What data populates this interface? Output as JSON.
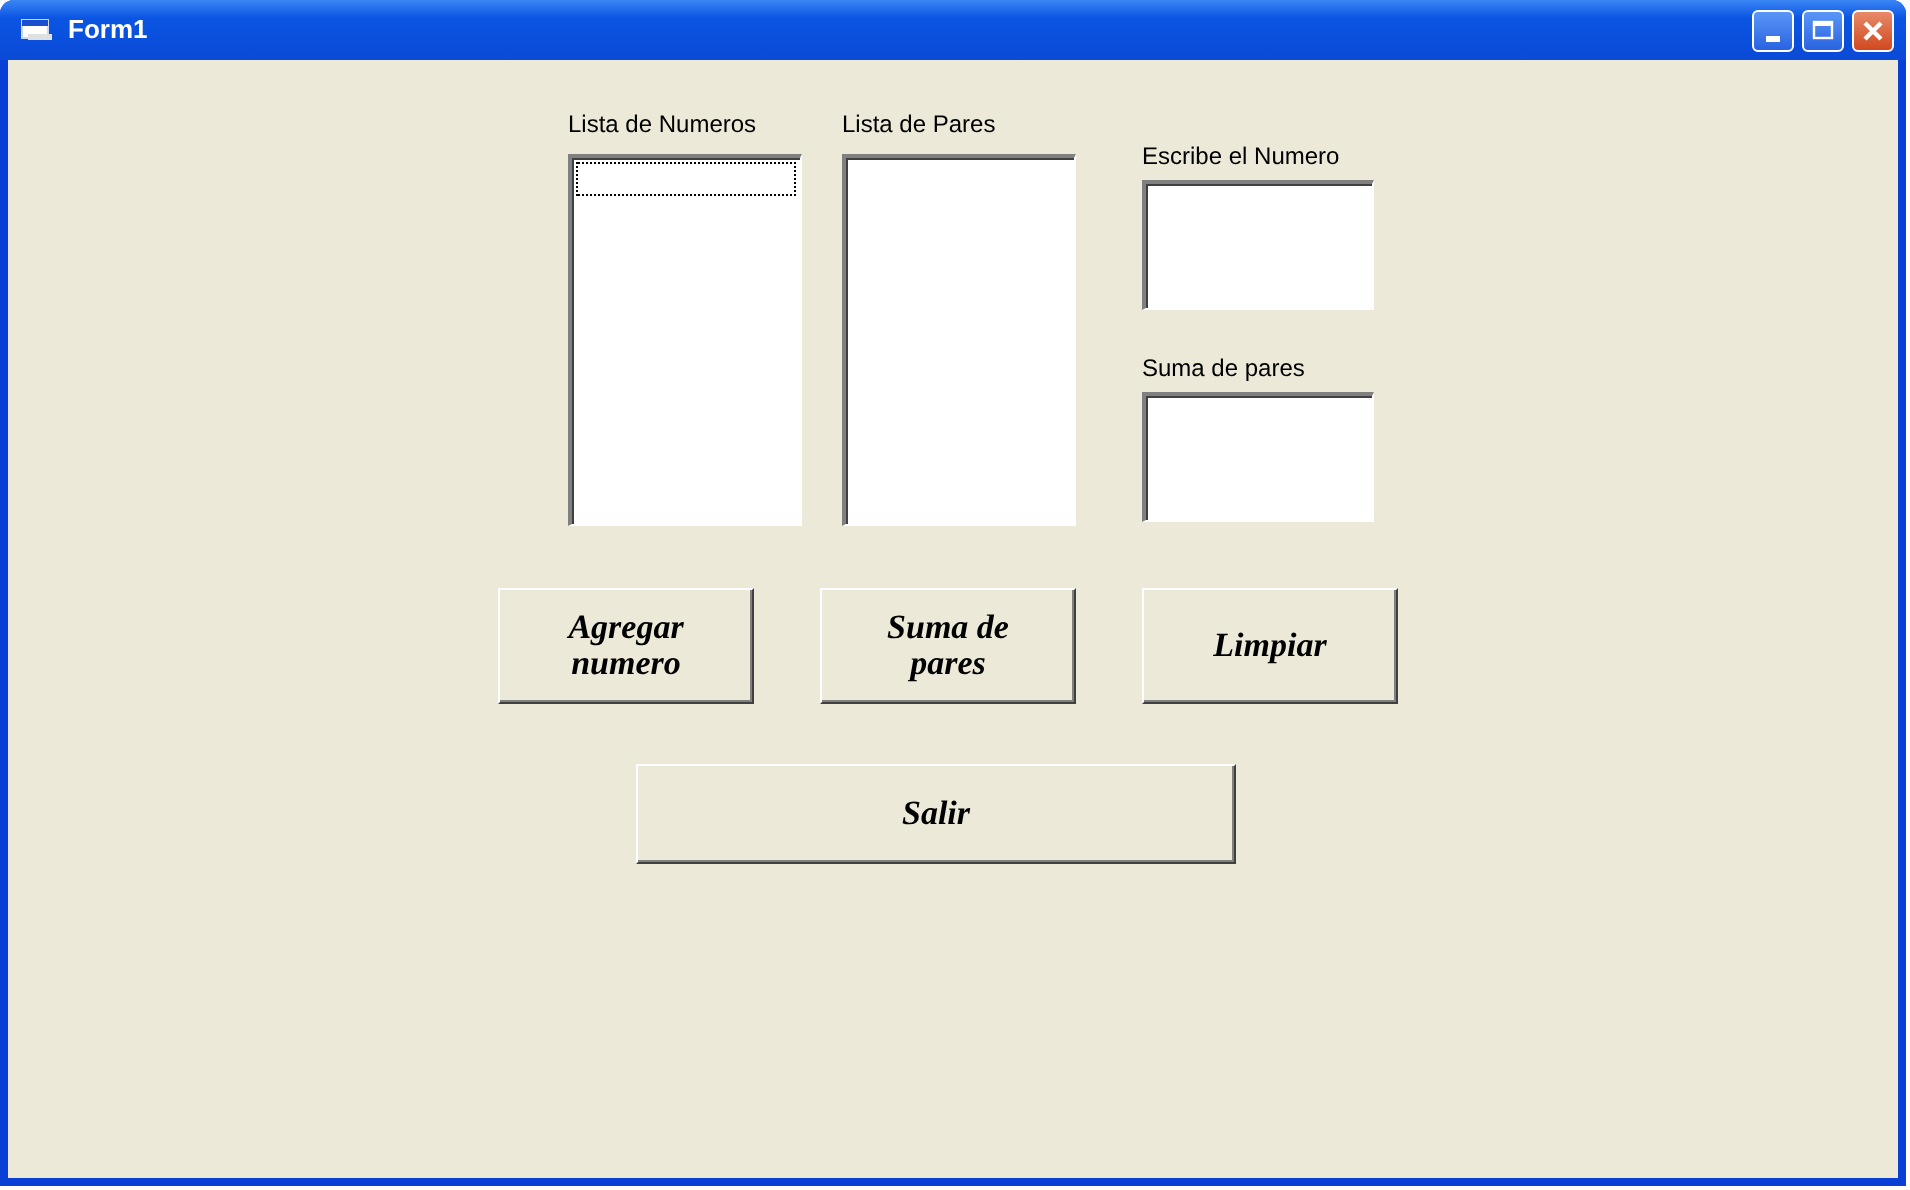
{
  "window": {
    "title": "Form1"
  },
  "lists": [
    {
      "label": "Lista de Numeros",
      "focused": true
    },
    {
      "label": "Lista de Pares",
      "focused": false
    }
  ],
  "fields": [
    {
      "label": "Escribe el Numero"
    },
    {
      "label": "Suma de pares"
    }
  ],
  "buttons": [
    {
      "label": "Agregar numero"
    },
    {
      "label": "Suma de pares"
    },
    {
      "label": "Limpiar"
    }
  ],
  "exit_button": {
    "label": "Salir"
  }
}
